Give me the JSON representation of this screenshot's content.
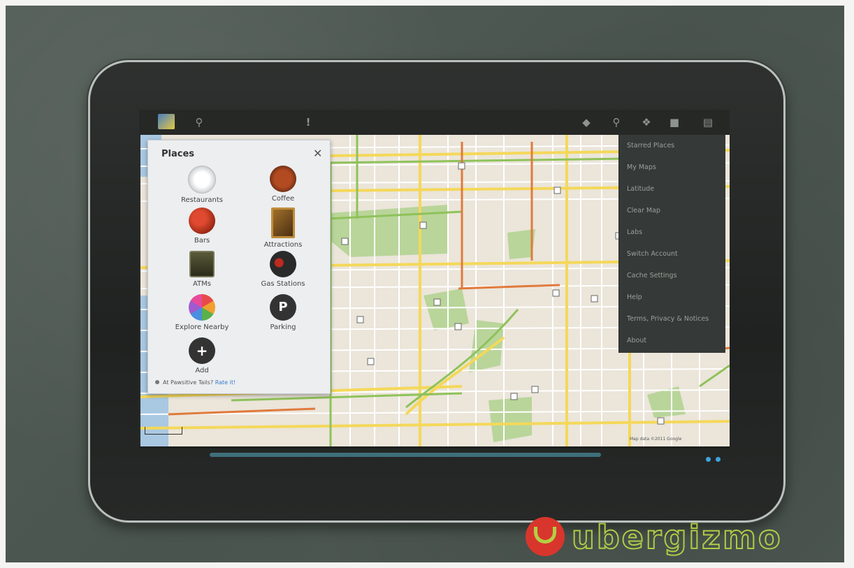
{
  "panel": {
    "title": "Places",
    "close_icon": "close-icon",
    "items": [
      {
        "label": "Restaurants",
        "icon": "plate-icon",
        "color": "#f4f4f4"
      },
      {
        "label": "Coffee",
        "icon": "coffee-cup-icon",
        "color": "#8b3a1e"
      },
      {
        "label": "Bars",
        "icon": "bar-glass-icon",
        "color": "#b8321e"
      },
      {
        "label": "Attractions",
        "icon": "painting-icon",
        "color": "#8b5a20"
      },
      {
        "label": "ATMs",
        "icon": "atm-icon",
        "color": "#6a6a40"
      },
      {
        "label": "Gas Stations",
        "icon": "gas-pump-icon",
        "color": "#3a3a3a"
      },
      {
        "label": "Explore Nearby",
        "icon": "pinwheel-icon",
        "color": "#e04848"
      },
      {
        "label": "Parking",
        "icon": "parking-icon",
        "color": "#333333"
      },
      {
        "label": "Add",
        "icon": "add-icon",
        "color": "#333333"
      }
    ],
    "footer_text": "At Pawsitive Tails?",
    "footer_link": "Rate it!"
  },
  "menu": {
    "items": [
      "Starred Places",
      "My Maps",
      "Latitude",
      "Clear Map",
      "Labs",
      "Switch Account",
      "Cache Settings",
      "Help",
      "Terms, Privacy & Notices",
      "About"
    ]
  },
  "map": {
    "attribution": "Map data ©2011 Google"
  },
  "watermark": {
    "brand": "ubergizmo"
  }
}
